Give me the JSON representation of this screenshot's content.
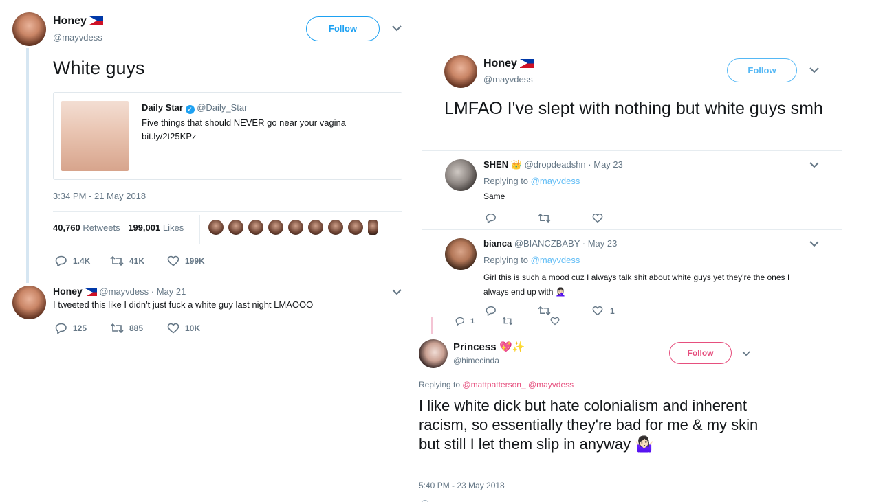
{
  "left": {
    "main_tweet": {
      "name": "Honey",
      "handle": "@mayvdess",
      "follow_label": "Follow",
      "text": "White guys",
      "card": {
        "source_name": "Daily Star",
        "source_handle": "@Daily_Star",
        "headline": "Five things that should NEVER go near your vagina",
        "link": "bit.ly/2t25KPz"
      },
      "timestamp": "3:34 PM - 21 May 2018",
      "retweets_count": "40,760",
      "retweets_label": "Retweets",
      "likes_count": "199,001",
      "likes_label": "Likes",
      "actions": {
        "replies": "1.4K",
        "retweets": "41K",
        "likes": "199K"
      }
    },
    "reply": {
      "name": "Honey",
      "handle": "@mayvdess",
      "date": "· May 21",
      "text": "I tweeted this like I didn't just fuck a white guy last night LMAOOO",
      "actions": {
        "replies": "125",
        "retweets": "885",
        "likes": "10K"
      }
    }
  },
  "right": {
    "main_tweet": {
      "name": "Honey",
      "handle": "@mayvdess",
      "follow_label": "Follow",
      "text": "LMFAO I've slept with nothing but white guys smh"
    },
    "replies": [
      {
        "name": "SHEN",
        "name_emoji": "👑",
        "handle": "@dropdeadshn",
        "date": "· May 23",
        "replying_prefix": "Replying to",
        "replying_to": "@mayvdess",
        "text": "Same"
      },
      {
        "name": "bianca",
        "handle": "@BIANCZBABY",
        "date": "· May 23",
        "replying_prefix": "Replying to",
        "replying_to": "@mayvdess",
        "text": "Girl this is such a mood cuz I always talk shit about white guys yet they're the ones I always end up with",
        "text_emoji": "🤦🏻‍♀️",
        "likes": "1"
      }
    ],
    "thread_actions": {
      "replies": "1"
    },
    "princess": {
      "name": "Princess",
      "name_emoji": "💖✨",
      "handle": "@himecinda",
      "follow_label": "Follow",
      "replying_prefix": "Replying to",
      "replying_to": "@mattpatterson_ @mayvdess",
      "text": "I like white dick but hate colonialism and inherent racism, so essentially they're bad for me & my skin but still I let them slip in anyway",
      "text_emoji": "🤷🏻‍♀️",
      "timestamp": "5:40 PM - 23 May 2018"
    }
  }
}
